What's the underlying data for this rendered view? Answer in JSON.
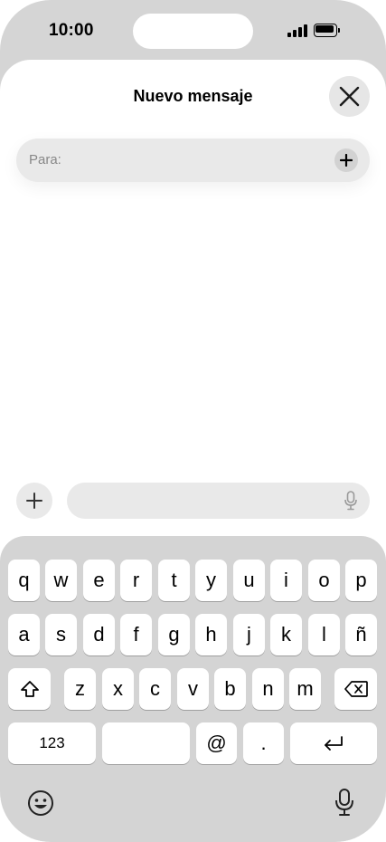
{
  "status_bar": {
    "time": "10:00"
  },
  "sheet": {
    "title": "Nuevo mensaje",
    "to_label": "Para:"
  },
  "keyboard": {
    "row1": [
      "q",
      "w",
      "e",
      "r",
      "t",
      "y",
      "u",
      "i",
      "o",
      "p"
    ],
    "row2": [
      "a",
      "s",
      "d",
      "f",
      "g",
      "h",
      "j",
      "k",
      "l",
      "ñ"
    ],
    "row3": [
      "z",
      "x",
      "c",
      "v",
      "b",
      "n",
      "m"
    ],
    "numbers_label": "123",
    "at_label": "@",
    "dot_label": "."
  },
  "icons": {
    "close": "close-icon",
    "add": "plus-icon",
    "mic": "microphone-icon",
    "shift": "shift-icon",
    "delete": "backspace-icon",
    "return": "return-icon",
    "emoji": "emoji-icon",
    "dictation": "microphone-icon"
  }
}
